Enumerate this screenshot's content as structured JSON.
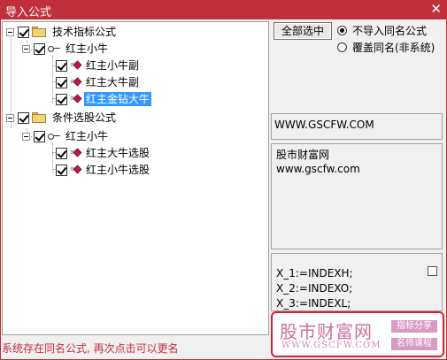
{
  "window": {
    "title": "导入公式",
    "close_glyph": "✕",
    "accent_color": "#c0303b"
  },
  "tree": {
    "groups": [
      {
        "label": "技术指标公式",
        "checked": true,
        "children": [
          {
            "label": "红主小牛",
            "checked": true,
            "items": [
              {
                "label": "红主小牛副",
                "checked": true,
                "selected": false
              },
              {
                "label": "红主大牛副",
                "checked": true,
                "selected": false
              },
              {
                "label": "红主金钻大牛",
                "checked": true,
                "selected": true
              }
            ]
          }
        ]
      },
      {
        "label": "条件选股公式",
        "checked": true,
        "children": [
          {
            "label": "红主小牛",
            "checked": true,
            "items": [
              {
                "label": "红主大牛选股",
                "checked": true,
                "selected": false
              },
              {
                "label": "红主小牛选股",
                "checked": true,
                "selected": false
              }
            ]
          }
        ]
      }
    ]
  },
  "controls": {
    "select_all_label": "全部选中",
    "radio_skip_label": "不导入同名公式",
    "radio_overwrite_label": "覆盖同名(非系统)",
    "radio_selected": "skip"
  },
  "info": {
    "url_text": "WWW.GSCFW.COM",
    "site_name": "股市财富网",
    "site_url": "www.gscfw.com",
    "formula_lines": [
      "X_1:=INDEXH;",
      "X_2:=INDEXO;",
      "X_3:=INDEXL;"
    ]
  },
  "status_text": "系统存在同名公式, 再次点击可以更名",
  "watermark": {
    "name": "股市财富网",
    "url": "WWW.GSCFW.COM",
    "tag1": "指标分享",
    "tag2": "名师课程"
  }
}
